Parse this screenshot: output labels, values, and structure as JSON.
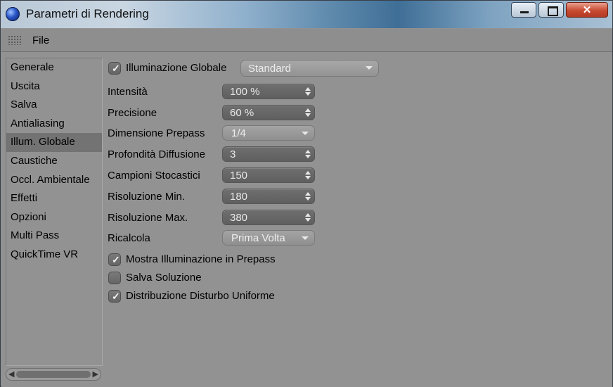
{
  "window": {
    "title": "Parametri di Rendering"
  },
  "menu": {
    "file": "File"
  },
  "sidebar": {
    "items": [
      {
        "label": "Generale"
      },
      {
        "label": "Uscita"
      },
      {
        "label": "Salva"
      },
      {
        "label": "Antialiasing"
      },
      {
        "label": "Illum. Globale",
        "active": true
      },
      {
        "label": "Caustiche"
      },
      {
        "label": "Occl. Ambientale"
      },
      {
        "label": "Effetti"
      },
      {
        "label": "Opzioni"
      },
      {
        "label": "Multi Pass"
      },
      {
        "label": "QuickTime VR"
      }
    ]
  },
  "gi": {
    "enable_label": "Illuminazione Globale",
    "enabled": true,
    "mode": "Standard"
  },
  "fields": {
    "intensita": {
      "label": "Intensità",
      "value": "100 %"
    },
    "precisione": {
      "label": "Precisione",
      "value": "60 %"
    },
    "dimensione_prepass": {
      "label": "Dimensione Prepass",
      "value": "1/4"
    },
    "profondita_diffusione": {
      "label": "Profondità Diffusione",
      "value": "3"
    },
    "campioni_stocastici": {
      "label": "Campioni Stocastici",
      "value": "150"
    },
    "risoluzione_min": {
      "label": "Risoluzione Min.",
      "value": "180"
    },
    "risoluzione_max": {
      "label": "Risoluzione Max.",
      "value": "380"
    },
    "ricalcola": {
      "label": "Ricalcola",
      "value": "Prima Volta"
    }
  },
  "checkboxes": {
    "mostra": {
      "label": "Mostra Illuminazione in Prepass",
      "checked": true
    },
    "salva": {
      "label": "Salva Soluzione",
      "checked": false
    },
    "distribuzione": {
      "label": "Distribuzione Disturbo Uniforme",
      "checked": true
    }
  }
}
